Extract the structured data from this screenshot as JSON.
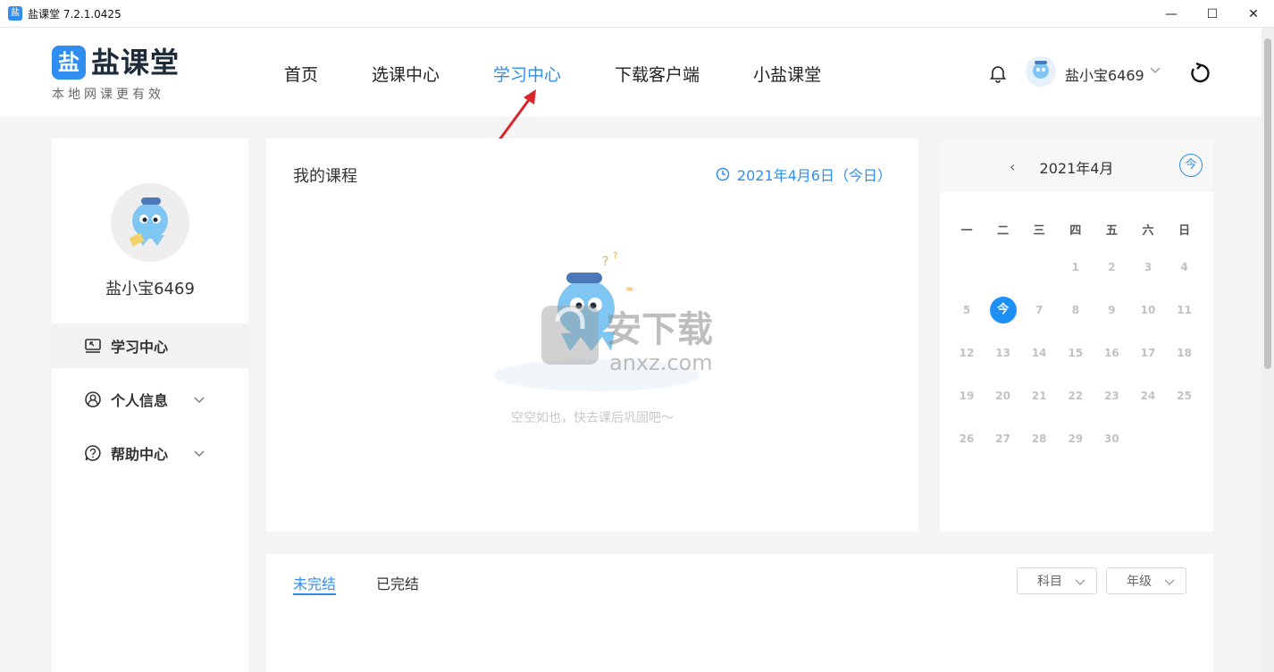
{
  "window": {
    "title": "盐课堂 7.2.1.0425",
    "app_icon_glyph": "盐",
    "minimize": "—",
    "maximize": "☐",
    "close": "✕"
  },
  "header": {
    "logo_mark": "盐",
    "logo_name": "盐课堂",
    "logo_slogan": "本地网课更有效",
    "nav": [
      "首页",
      "选课中心",
      "学习中心",
      "下载客户端",
      "小盐课堂"
    ],
    "active_nav": "学习中心",
    "user_name": "盐小宝6469"
  },
  "sidebar": {
    "user_name": "盐小宝6469",
    "items": [
      {
        "label": "学习中心",
        "icon": "study-icon"
      },
      {
        "label": "个人信息",
        "icon": "user-icon"
      },
      {
        "label": "帮助中心",
        "icon": "help-icon"
      }
    ]
  },
  "courses": {
    "title": "我的课程",
    "date": "2021年4月6日（今日）",
    "empty_text": "空空如也，快去课后巩固吧～"
  },
  "calendar": {
    "month": "2021年4月",
    "prev": "‹",
    "next": "›",
    "today_button": "今",
    "weekdays": [
      "一",
      "二",
      "三",
      "四",
      "五",
      "六",
      "日"
    ],
    "days": [
      "1",
      "2",
      "3",
      "4",
      "5",
      "今",
      "7",
      "8",
      "9",
      "10",
      "11",
      "12",
      "13",
      "14",
      "15",
      "16",
      "17",
      "18",
      "19",
      "20",
      "21",
      "22",
      "23",
      "24",
      "25",
      "26",
      "27",
      "28",
      "29",
      "30"
    ],
    "first_weekday_index": 3,
    "today_index": 5
  },
  "bottom": {
    "tabs": [
      "未完结",
      "已完结"
    ],
    "filters": [
      "科目",
      "年级"
    ]
  },
  "watermark": {
    "text": "安下载",
    "domain": "anxz.com"
  },
  "colors": {
    "accent": "#2f8ef0",
    "today": "#1e90f5",
    "annotation": "#d9252a"
  }
}
